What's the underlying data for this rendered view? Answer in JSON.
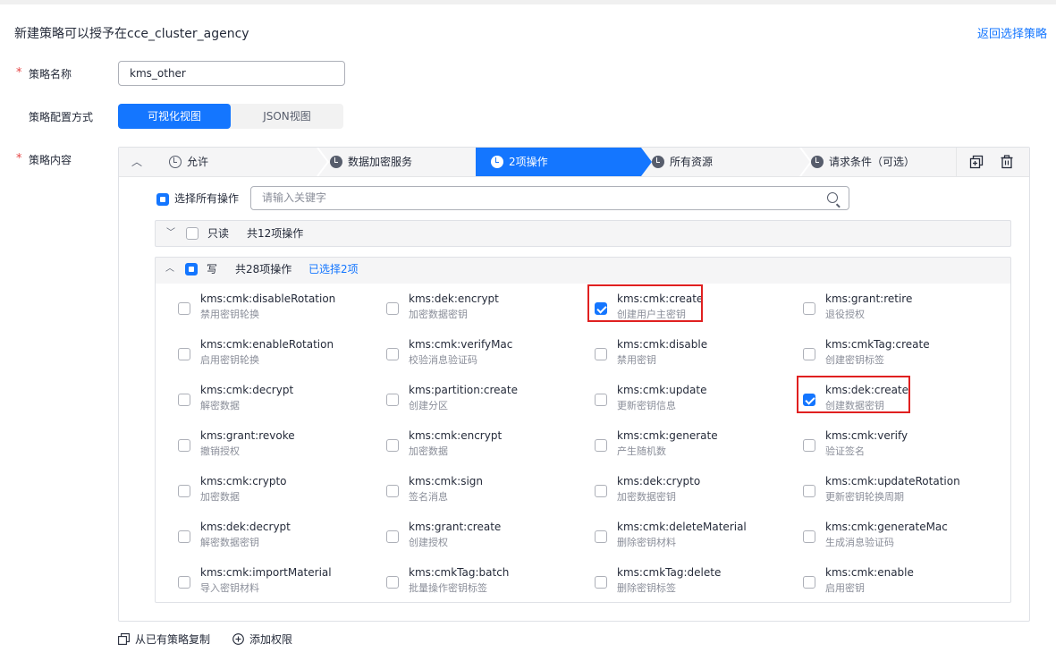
{
  "header": {
    "title": "新建策略可以授予在cce_cluster_agency",
    "back_link": "返回选择策略"
  },
  "form": {
    "name_label": "策略名称",
    "name_value": "kms_other",
    "config_label": "策略配置方式",
    "config_options": [
      "可视化视图",
      "JSON视图"
    ],
    "content_label": "策略内容"
  },
  "steps": [
    "允许",
    "数据加密服务",
    "2项操作",
    "所有资源",
    "请求条件（可选）"
  ],
  "select_all_label": "选择所有操作",
  "search_placeholder": "请输入关键字",
  "readonly_group": {
    "name": "只读",
    "count": "共12项操作"
  },
  "write_group": {
    "name": "写",
    "count": "共28项操作",
    "selected": "已选择2项"
  },
  "actions": [
    {
      "name": "kms:cmk:disableRotation",
      "desc": "禁用密钥轮换",
      "checked": false
    },
    {
      "name": "kms:dek:encrypt",
      "desc": "加密数据密钥",
      "checked": false
    },
    {
      "name": "kms:cmk:create",
      "desc": "创建用户主密钥",
      "checked": true
    },
    {
      "name": "kms:grant:retire",
      "desc": "退役授权",
      "checked": false
    },
    {
      "name": "kms:cmk:enableRotation",
      "desc": "启用密钥轮换",
      "checked": false
    },
    {
      "name": "kms:cmk:verifyMac",
      "desc": "校验消息验证码",
      "checked": false
    },
    {
      "name": "kms:cmk:disable",
      "desc": "禁用密钥",
      "checked": false
    },
    {
      "name": "kms:cmkTag:create",
      "desc": "创建密钥标签",
      "checked": false
    },
    {
      "name": "kms:cmk:decrypt",
      "desc": "解密数据",
      "checked": false
    },
    {
      "name": "kms:partition:create",
      "desc": "创建分区",
      "checked": false
    },
    {
      "name": "kms:cmk:update",
      "desc": "更新密钥信息",
      "checked": false
    },
    {
      "name": "kms:dek:create",
      "desc": "创建数据密钥",
      "checked": true
    },
    {
      "name": "kms:grant:revoke",
      "desc": "撤销授权",
      "checked": false
    },
    {
      "name": "kms:cmk:encrypt",
      "desc": "加密数据",
      "checked": false
    },
    {
      "name": "kms:cmk:generate",
      "desc": "产生随机数",
      "checked": false
    },
    {
      "name": "kms:cmk:verify",
      "desc": "验证签名",
      "checked": false
    },
    {
      "name": "kms:cmk:crypto",
      "desc": "加密数据",
      "checked": false
    },
    {
      "name": "kms:cmk:sign",
      "desc": "签名消息",
      "checked": false
    },
    {
      "name": "kms:dek:crypto",
      "desc": "加密数据密钥",
      "checked": false
    },
    {
      "name": "kms:cmk:updateRotation",
      "desc": "更新密钥轮换周期",
      "checked": false
    },
    {
      "name": "kms:dek:decrypt",
      "desc": "解密数据密钥",
      "checked": false
    },
    {
      "name": "kms:grant:create",
      "desc": "创建授权",
      "checked": false
    },
    {
      "name": "kms:cmk:deleteMaterial",
      "desc": "删除密钥材料",
      "checked": false
    },
    {
      "name": "kms:cmk:generateMac",
      "desc": "生成消息验证码",
      "checked": false
    },
    {
      "name": "kms:cmk:importMaterial",
      "desc": "导入密钥材料",
      "checked": false
    },
    {
      "name": "kms:cmkTag:batch",
      "desc": "批量操作密钥标签",
      "checked": false
    },
    {
      "name": "kms:cmkTag:delete",
      "desc": "删除密钥标签",
      "checked": false
    },
    {
      "name": "kms:cmk:enable",
      "desc": "启用密钥",
      "checked": false
    }
  ],
  "footer": {
    "copy_label": "从已有策略复制",
    "add_label": "添加权限"
  },
  "colors": {
    "accent": "#1476ff",
    "highlight": "#e02020"
  }
}
